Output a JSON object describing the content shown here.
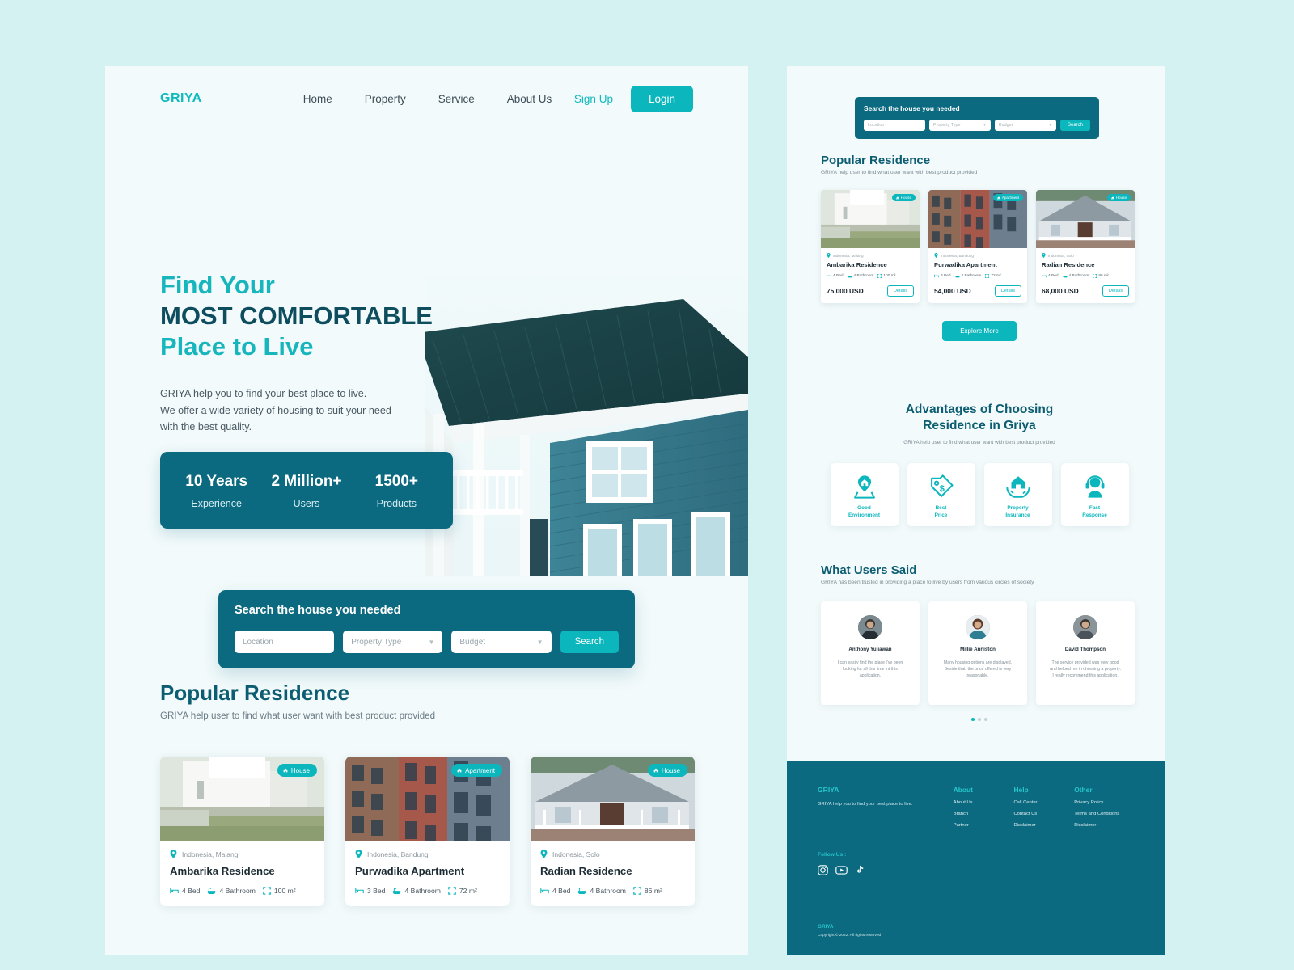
{
  "brand": "GRIYA",
  "header": {
    "nav": [
      "Home",
      "Property",
      "Service",
      "About Us"
    ],
    "signup": "Sign Up",
    "login": "Login"
  },
  "hero": {
    "line1": "Find Your",
    "line2": "MOST COMFORTABLE",
    "line3": "Place to Live",
    "paragraph_1": "GRIYA help you to find your best place to live.",
    "paragraph_2": "We offer a wide variety of housing to suit your need",
    "paragraph_3": "with the best quality.",
    "stats": [
      {
        "number": "10 Years",
        "label": "Experience"
      },
      {
        "number": "2 Million+",
        "label": "Users"
      },
      {
        "number": "1500+",
        "label": "Products"
      }
    ]
  },
  "search": {
    "title": "Search the house you needed",
    "location_placeholder": "Location",
    "property_type_placeholder": "Property Type",
    "budget_placeholder": "Budget",
    "button": "Search"
  },
  "popular": {
    "title": "Popular Residence",
    "subtitle": "GRIYA help user to find what user want with best product provided",
    "explore_button": "Explore More",
    "details_button": "Details",
    "items": [
      {
        "badge": "House",
        "badge_icon": "home-icon",
        "location": "Indonesia, Malang",
        "name": "Ambarika Residence",
        "bed": "4 Bed",
        "bathroom": "4 Bathroom",
        "area": "100 m²",
        "price": "75,000 USD"
      },
      {
        "badge": "Apartment",
        "badge_icon": "home-icon",
        "location": "Indonesia, Bandung",
        "name": "Purwadika Apartment",
        "bed": "3 Bed",
        "bathroom": "4 Bathroom",
        "area": "72 m²",
        "price": "54,000 USD"
      },
      {
        "badge": "House",
        "badge_icon": "home-icon",
        "location": "Indonesia, Solo",
        "name": "Radian Residence",
        "bed": "4 Bed",
        "bathroom": "4 Bathroom",
        "area": "86 m²",
        "price": "68,000 USD"
      }
    ]
  },
  "advantages": {
    "title_line1": "Advantages of Choosing",
    "title_line2": "Residence in Griya",
    "subtitle": "GRIYA help user to find what user want with best product provided",
    "items": [
      {
        "icon": "location-pin-home-icon",
        "label_line1": "Good",
        "label_line2": "Environment"
      },
      {
        "icon": "price-tag-icon",
        "label_line1": "Best",
        "label_line2": "Price"
      },
      {
        "icon": "hands-home-icon",
        "label_line1": "Property",
        "label_line2": "Insurance"
      },
      {
        "icon": "headset-support-icon",
        "label_line1": "Fast",
        "label_line2": "Response"
      }
    ]
  },
  "testimonials": {
    "title": "What Users Said",
    "subtitle": "GRIYA has been trusted in providing a place to live by users from various circles of society",
    "items": [
      {
        "name": "Anthony Yuliawan",
        "quote": "I can easily find the place I've been looking for all this time int this application."
      },
      {
        "name": "Millie Anniston",
        "quote": "Many housing options are displayed. Beside that, the price offered is very reasonable."
      },
      {
        "name": "David Thompson",
        "quote": "The service provided was very good and helped me in choosing a property. I really recommend this application."
      }
    ],
    "active_dot": 0,
    "dot_count": 3
  },
  "footer": {
    "brand": "GRIYA",
    "description": "GRIYA help you to find your best place to live.",
    "columns": [
      {
        "heading": "About",
        "links": [
          "About Us",
          "Branch",
          "Partner"
        ]
      },
      {
        "heading": "Help",
        "links": [
          "Call Center",
          "Contact Us",
          "Disclaimer"
        ]
      },
      {
        "heading": "Other",
        "links": [
          "Privacy Policy",
          "Terms and Conditions",
          "Disclaimer"
        ]
      }
    ],
    "follow_label": "Follow Us :",
    "socials": [
      "instagram-icon",
      "youtube-icon",
      "tiktok-icon"
    ],
    "bottom_brand": "GRIYA",
    "copyright": "Copyright  ©  2022. All rights reserved"
  },
  "colors": {
    "accent": "#0bb7bd",
    "dark_teal": "#0b6a80",
    "heading": "#0d5d72",
    "page_bg": "#d5f2f2",
    "panel_bg": "#f2fafb"
  }
}
